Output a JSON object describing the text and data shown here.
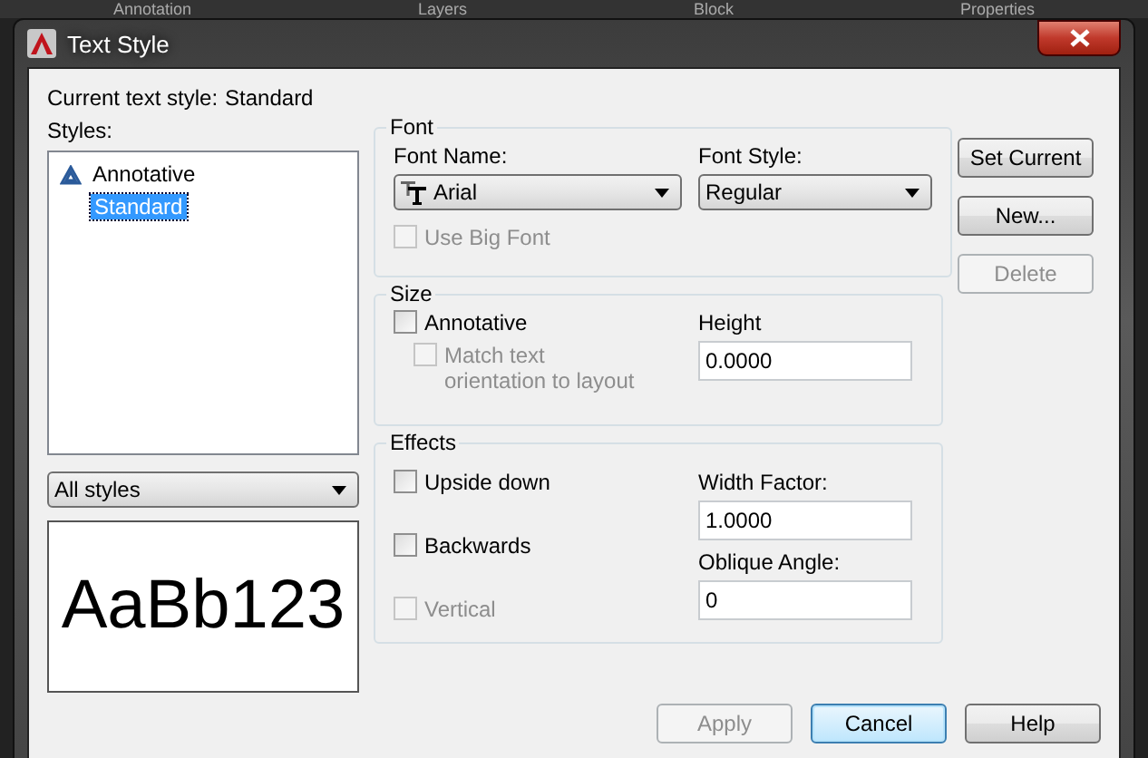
{
  "ribbon_tabs": [
    "Annotation",
    "Layers",
    "Block",
    "Properties"
  ],
  "window": {
    "title": "Text Style"
  },
  "current_style": {
    "label": "Current text style:",
    "value": "Standard"
  },
  "styles": {
    "label": "Styles:",
    "items": [
      {
        "label": "Annotative",
        "annotative": true,
        "selected": false
      },
      {
        "label": "Standard",
        "annotative": false,
        "selected": true
      }
    ]
  },
  "filter": {
    "value": "All styles"
  },
  "preview": {
    "text": "AaBb123"
  },
  "font": {
    "legend": "Font",
    "font_name": {
      "label": "Font Name:",
      "value": "Arial"
    },
    "font_style": {
      "label": "Font Style:",
      "value": "Regular"
    },
    "use_big_font": {
      "label": "Use Big Font",
      "checked": false,
      "disabled": true
    }
  },
  "size": {
    "legend": "Size",
    "annotative": {
      "label": "Annotative",
      "checked": false,
      "disabled": false
    },
    "match_orientation": {
      "label": "Match text orientation to layout",
      "checked": false,
      "disabled": true
    },
    "height": {
      "label": "Height",
      "value": "0.0000"
    }
  },
  "effects": {
    "legend": "Effects",
    "checkboxes": [
      {
        "label": "Upside down",
        "checked": false,
        "disabled": false
      },
      {
        "label": "Backwards",
        "checked": false,
        "disabled": false
      },
      {
        "label": "Vertical",
        "checked": false,
        "disabled": true
      }
    ],
    "width_factor": {
      "label": "Width Factor:",
      "value": "1.0000"
    },
    "oblique_angle": {
      "label": "Oblique Angle:",
      "value": "0"
    }
  },
  "side_buttons": [
    {
      "label": "Set Current",
      "disabled": false
    },
    {
      "label": "New...",
      "disabled": false
    },
    {
      "label": "Delete",
      "disabled": true
    }
  ],
  "footer_buttons": [
    {
      "label": "Apply",
      "disabled": true,
      "default": false
    },
    {
      "label": "Cancel",
      "disabled": false,
      "default": true
    },
    {
      "label": "Help",
      "disabled": false,
      "default": false
    }
  ]
}
